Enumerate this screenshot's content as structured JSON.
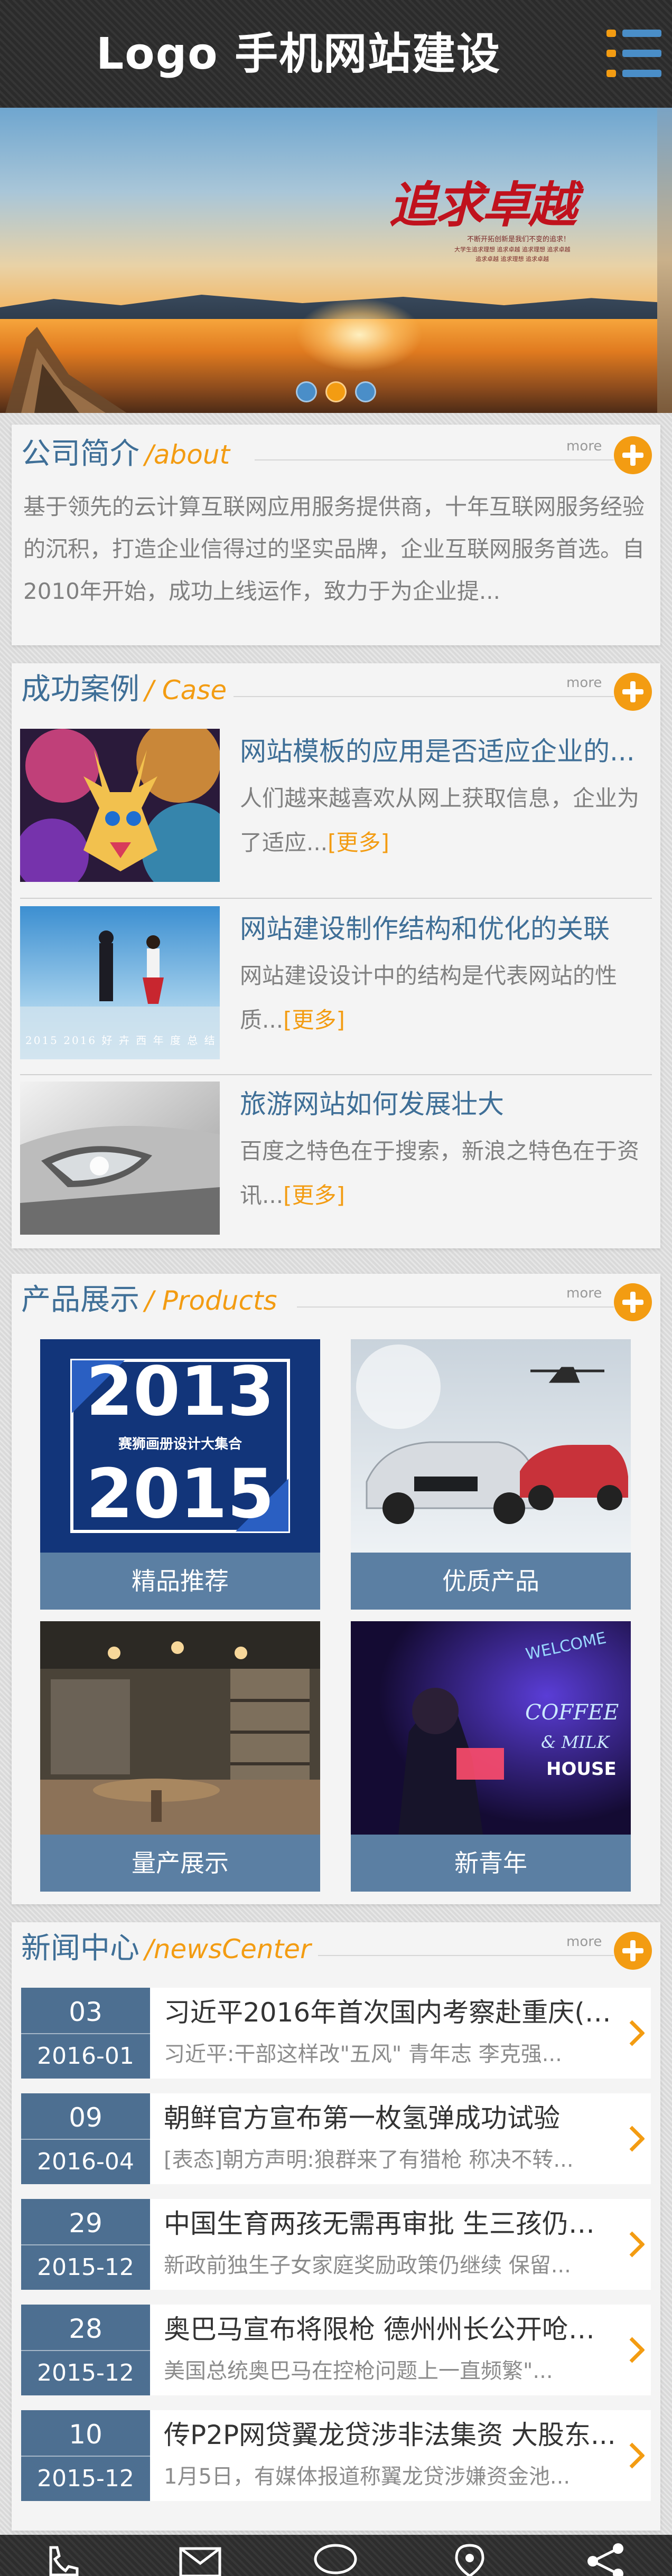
{
  "header": {
    "logo_text": "Logo 手机网站建设",
    "menu_icon": "menu-icon"
  },
  "banner": {
    "slogan": "追求卓越",
    "tagline_1": "不断开拓创新是我们不变的追求！",
    "tagline_2": "大学生追求理想 追求卓越 追求理想 追求卓越",
    "tagline_3": "追求卓越 追求理想 追求卓越",
    "slides": 3,
    "active_slide": 2,
    "colors": {
      "dot": "#4a8ec8",
      "dot_active": "#f39c12"
    }
  },
  "about": {
    "title": "公司简介",
    "subtitle": "/about",
    "more": "more",
    "text": "基于领先的云计算互联网应用服务提供商，十年互联网服务经验的沉积，打造企业信得过的坚实品牌，企业互联网服务首选。自2010年开始，成功上线运作，致力于为企业提..."
  },
  "cases": {
    "title": "成功案例",
    "subtitle": "/ Case",
    "more": "more",
    "more_link": "[更多]",
    "items": [
      {
        "title": "网站模板的应用是否适应企业的...",
        "desc": "人们越来越喜欢从网上获取信息，企业为了适应...",
        "image": "colorful-deer-illustration"
      },
      {
        "title": "网站建设制作结构和优化的关联",
        "desc": "网站建设设计中的结构是代表网站的性质...",
        "image": "couple-on-salt-flat",
        "photo_caption": "2015 2016 好 卉 西 年 度 总 结"
      },
      {
        "title": "旅游网站如何发展壮大",
        "desc": "百度之特色在于搜索，新浪之特色在于资讯...",
        "image": "silver-car-headlight"
      }
    ]
  },
  "products": {
    "title": "产品展示",
    "subtitle": "/ Products",
    "more": "more",
    "items": [
      {
        "label": "精品推荐",
        "image": "2013-2015-poster",
        "poster_top": "2013",
        "poster_mid": "赛狮画册设计大集合",
        "poster_bottom": "2015"
      },
      {
        "label": "优质产品",
        "image": "cars-in-snow-with-helicopter"
      },
      {
        "label": "量产展示",
        "image": "modern-cafe-interior"
      },
      {
        "label": "新青年",
        "image": "neon-coffee-sign",
        "neon_text_1": "WELCOME",
        "neon_text_2": "COFFEE",
        "neon_text_3": "& MILK",
        "neon_text_4": "HOUSE"
      }
    ]
  },
  "news": {
    "title": "新闻中心",
    "subtitle": "/newsCenter",
    "more": "more",
    "items": [
      {
        "day": "03",
        "ym": "2016-01",
        "title": "习近平2016年首次国内考察赴重庆(图)",
        "summary": "习近平:干部这样改\"五风\" 青年志 李克强..."
      },
      {
        "day": "09",
        "ym": "2016-04",
        "title": "朝鲜官方宣布第一枚氢弹成功试验",
        "summary": "[表态]朝方声明:狼群来了有猎枪 称决不转..."
      },
      {
        "day": "29",
        "ym": "2015-12",
        "title": "中国生育两孩无需再审批 生三孩仍将...",
        "summary": "新政前独生子女家庭奖励政策仍继续 保留..."
      },
      {
        "day": "28",
        "ym": "2015-12",
        "title": "奥巴马宣布将限枪 德州州长公开呛声...",
        "summary": "美国总统奥巴马在控枪问题上一直频繁\"..."
      },
      {
        "day": "10",
        "ym": "2015-12",
        "title": "传P2P网贷翼龙贷涉非法集资 大股东...",
        "summary": "1月5日，有媒体报道称翼龙贷涉嫌资金池..."
      }
    ]
  },
  "bottom_bar": {
    "icons": [
      "phone-icon",
      "mail-icon",
      "chat-icon",
      "location-icon",
      "share-icon"
    ]
  },
  "colors": {
    "accent": "#f39c12",
    "primary_blue": "#3f6f97",
    "label_blue": "#5b7fa3",
    "date_blue": "#4d6f91",
    "header_bg": "#2b2b2b"
  }
}
